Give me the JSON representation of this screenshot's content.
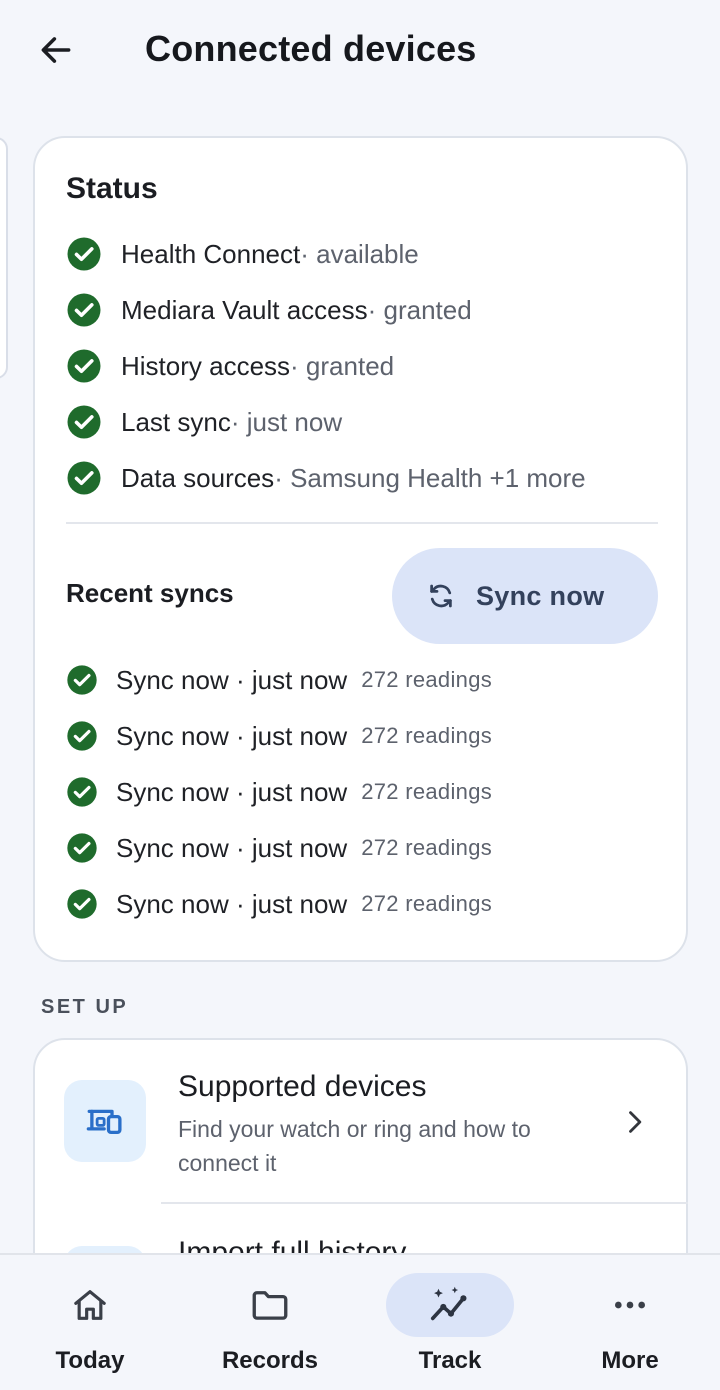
{
  "header": {
    "title": "Connected devices",
    "back_icon": "arrow-left-icon"
  },
  "status": {
    "title": "Status",
    "items": [
      {
        "label": "Health Connect",
        "value": " · available"
      },
      {
        "label": "Mediara Vault access",
        "value": " · granted"
      },
      {
        "label": "History access",
        "value": " · granted"
      },
      {
        "label": "Last sync",
        "value": " · just now"
      },
      {
        "label": "Data sources",
        "value": " · Samsung Health +1 more"
      }
    ]
  },
  "recent": {
    "title": "Recent syncs",
    "sync_button_label": "Sync now",
    "items": [
      {
        "main": "Sync now · just now",
        "count": "272 readings"
      },
      {
        "main": "Sync now · just now",
        "count": "272 readings"
      },
      {
        "main": "Sync now · just now",
        "count": "272 readings"
      },
      {
        "main": "Sync now · just now",
        "count": "272 readings"
      },
      {
        "main": "Sync now · just now",
        "count": "272 readings"
      }
    ]
  },
  "setup": {
    "label": "SET UP",
    "items": [
      {
        "title": "Supported devices",
        "subtitle": "Find your watch or ring and how to connect it"
      },
      {
        "title": "Import full history",
        "subtitle": ""
      }
    ]
  },
  "nav": {
    "items": [
      {
        "label": "Today",
        "icon": "home-icon"
      },
      {
        "label": "Records",
        "icon": "folder-icon"
      },
      {
        "label": "Track",
        "icon": "sparkle-trend-icon"
      },
      {
        "label": "More",
        "icon": "more-dots-icon"
      }
    ]
  },
  "colors": {
    "check": "#1f6b2c",
    "accent_bg": "#dbe4f8",
    "tile_bg": "#e3f0fd",
    "device_icon": "#2a6fc9"
  }
}
